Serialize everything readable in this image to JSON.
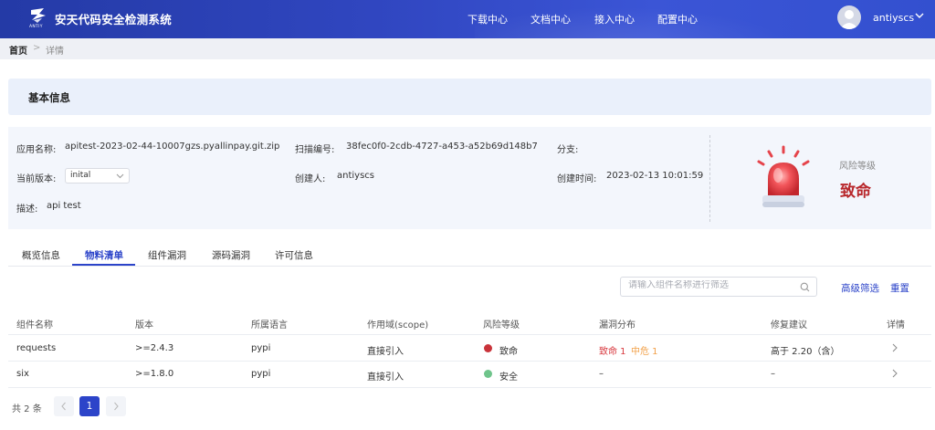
{
  "app": {
    "title": "安天代码安全检测系统",
    "logo_text": "ANTIY"
  },
  "nav": {
    "items": [
      "下载中心",
      "文档中心",
      "接入中心",
      "配置中心"
    ]
  },
  "user": {
    "name": "antiyscs"
  },
  "breadcrumb": {
    "home": "首页",
    "separator": ">",
    "current": "详情"
  },
  "basic_info": {
    "title": "基本信息",
    "app_name_label": "应用名称:",
    "app_name": "apitest-2023-02-44-10007gzs.pyallinpay.git.zip",
    "scan_id_label": "扫描编号:",
    "scan_id": "38fec0f0-2cdb-4727-a453-a52b69d148b7",
    "branch_label": "分支:",
    "branch": "",
    "version_label": "当前版本:",
    "version": "inital",
    "creator_label": "创建人:",
    "creator": "antiyscs",
    "created_time_label": "创建时间:",
    "created_time": "2023-02-13 10:01:59",
    "desc_label": "描述:",
    "desc": "api test",
    "risk_label": "风险等级",
    "risk_value": "致命",
    "risk_color": "#b8282c"
  },
  "tabs": [
    "概览信息",
    "物料清单",
    "组件漏洞",
    "源码漏洞",
    "许可信息"
  ],
  "active_tab": "物料清单",
  "filter": {
    "placeholder": "请输入组件名称进行筛选",
    "advanced": "高级筛选",
    "reset": "重置"
  },
  "table": {
    "headers": [
      "组件名称",
      "版本",
      "所属语言",
      "作用域(scope)",
      "风险等级",
      "漏洞分布",
      "修复建议",
      "详情"
    ],
    "rows": [
      {
        "name": "requests",
        "version": ">=2.4.3",
        "language": "pypi",
        "scope": "直接引入",
        "risk": "致命",
        "risk_color": "#c9333a",
        "vuln_fatal": "致命 1",
        "vuln_medium": "中危 1",
        "vuln": "",
        "fix": "高于 2.20（含）"
      },
      {
        "name": "six",
        "version": ">=1.8.0",
        "language": "pypi",
        "scope": "直接引入",
        "risk": "安全",
        "risk_color": "#6fc48b",
        "vuln_fatal": "",
        "vuln_medium": "",
        "vuln": "–",
        "fix": "–"
      }
    ]
  },
  "pagination": {
    "total": "共 2 条",
    "current_page": "1"
  },
  "icons": {
    "search": "search-icon",
    "alarm": "alarm-light-icon",
    "avatar": "user-avatar-icon"
  }
}
